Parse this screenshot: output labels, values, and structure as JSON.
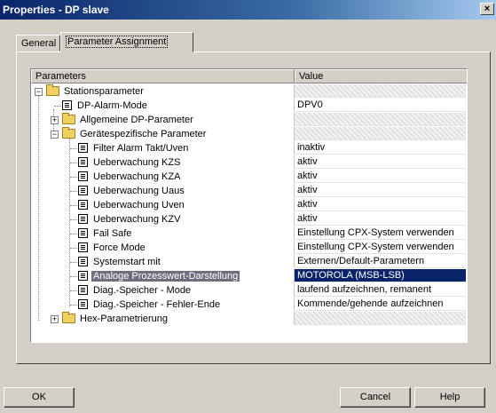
{
  "window": {
    "title": "Properties - DP slave",
    "close": "×"
  },
  "tabs": [
    {
      "label": "General"
    },
    {
      "label": "Parameter Assignment"
    }
  ],
  "grid": {
    "col_parameters": "Parameters",
    "col_value": "Value",
    "rows": [
      {
        "name": "Stationsparameter",
        "value": ""
      },
      {
        "name": "DP-Alarm-Mode",
        "value": "DPV0"
      },
      {
        "name": "Allgemeine DP-Parameter",
        "value": ""
      },
      {
        "name": "Gerätespezifische Parameter",
        "value": ""
      },
      {
        "name": "Filter Alarm Takt/Uven",
        "value": "inaktiv"
      },
      {
        "name": "Ueberwachung KZS",
        "value": "aktiv"
      },
      {
        "name": "Ueberwachung KZA",
        "value": "aktiv"
      },
      {
        "name": "Ueberwachung Uaus",
        "value": "aktiv"
      },
      {
        "name": "Ueberwachung Uven",
        "value": "aktiv"
      },
      {
        "name": "Ueberwachung KZV",
        "value": "aktiv"
      },
      {
        "name": "Fail Safe",
        "value": "Einstellung CPX-System verwenden"
      },
      {
        "name": "Force Mode",
        "value": "Einstellung CPX-System verwenden"
      },
      {
        "name": "Systemstart mit",
        "value": "Externen/Default-Parametern"
      },
      {
        "name": "Analoge Prozesswert-Darstellung",
        "value": "MOTOROLA (MSB-LSB)"
      },
      {
        "name": "Diag.-Speicher - Mode",
        "value": "laufend aufzeichnen, remanent"
      },
      {
        "name": "Diag.-Speicher - Fehler-Ende",
        "value": "Kommende/gehende aufzeichnen"
      },
      {
        "name": "Hex-Parametrierung",
        "value": ""
      }
    ]
  },
  "buttons": {
    "ok": "OK",
    "cancel": "Cancel",
    "help": "Help"
  }
}
